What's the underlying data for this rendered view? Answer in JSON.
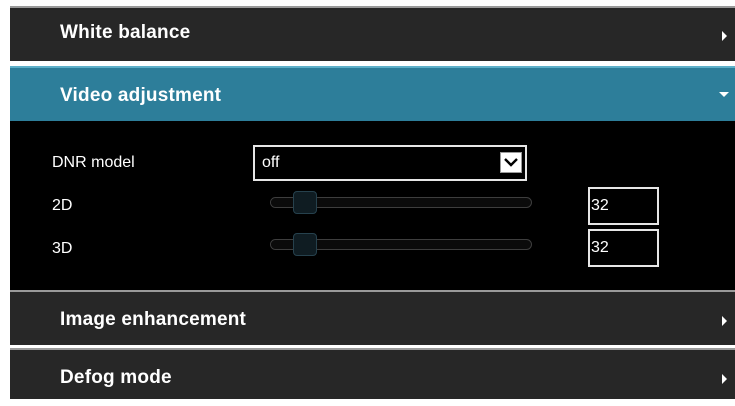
{
  "sections": {
    "white_balance": {
      "title": "White balance",
      "expanded": false
    },
    "video_adjustment": {
      "title": "Video adjustment",
      "expanded": true
    },
    "image_enhancement": {
      "title": "Image enhancement",
      "expanded": false
    },
    "defog_mode": {
      "title": "Defog mode",
      "expanded": false
    }
  },
  "video_adjustment": {
    "dnr_model": {
      "label": "DNR model",
      "value": "off"
    },
    "slider_2d": {
      "label": "2D",
      "value": "32",
      "fraction": 0.13
    },
    "slider_3d": {
      "label": "3D",
      "value": "32",
      "fraction": 0.13
    }
  },
  "colors": {
    "header_bg": "#272727",
    "active_header_bg": "#2d7e9a",
    "content_bg": "#000000",
    "text": "#ffffff"
  },
  "icons": {
    "collapsed": "chevron-right-icon",
    "expanded": "chevron-down-icon",
    "dropdown": "chevron-down-icon"
  }
}
